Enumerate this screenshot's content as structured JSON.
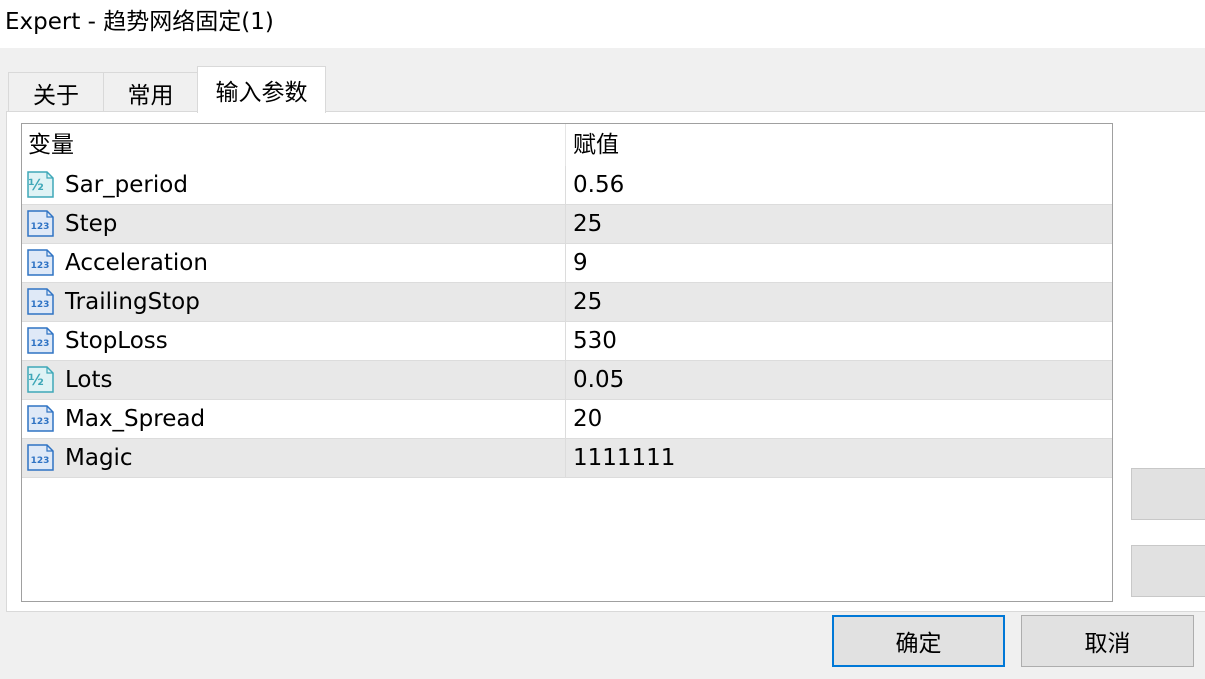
{
  "window": {
    "title": "Expert - 趋势网络固定(1)"
  },
  "tabs": [
    {
      "label": "关于",
      "active": false
    },
    {
      "label": "常用",
      "active": false
    },
    {
      "label": "输入参数",
      "active": true
    }
  ],
  "table": {
    "columns": [
      "变量",
      "赋值"
    ],
    "rows": [
      {
        "name": "Sar_period",
        "value": "0.56",
        "type_icon": "double-type-icon"
      },
      {
        "name": "Step",
        "value": "25",
        "type_icon": "integer-type-icon"
      },
      {
        "name": "Acceleration",
        "value": "9",
        "type_icon": "integer-type-icon"
      },
      {
        "name": "TrailingStop",
        "value": "25",
        "type_icon": "integer-type-icon"
      },
      {
        "name": "StopLoss",
        "value": "530",
        "type_icon": "integer-type-icon"
      },
      {
        "name": "Lots",
        "value": "0.05",
        "type_icon": "double-type-icon"
      },
      {
        "name": "Max_Spread",
        "value": "20",
        "type_icon": "integer-type-icon"
      },
      {
        "name": "Magic",
        "value": "1111111",
        "type_icon": "integer-type-icon"
      }
    ]
  },
  "icon_labels": {
    "double": "½",
    "integer": "123"
  },
  "buttons": {
    "ok_label": "确定",
    "cancel_label": "取消"
  },
  "colors": {
    "accent_border": "#0078d7",
    "row_alt": "#e8e8e8",
    "icon_blue": "#2f73c4",
    "icon_teal": "#3fa8b8"
  }
}
